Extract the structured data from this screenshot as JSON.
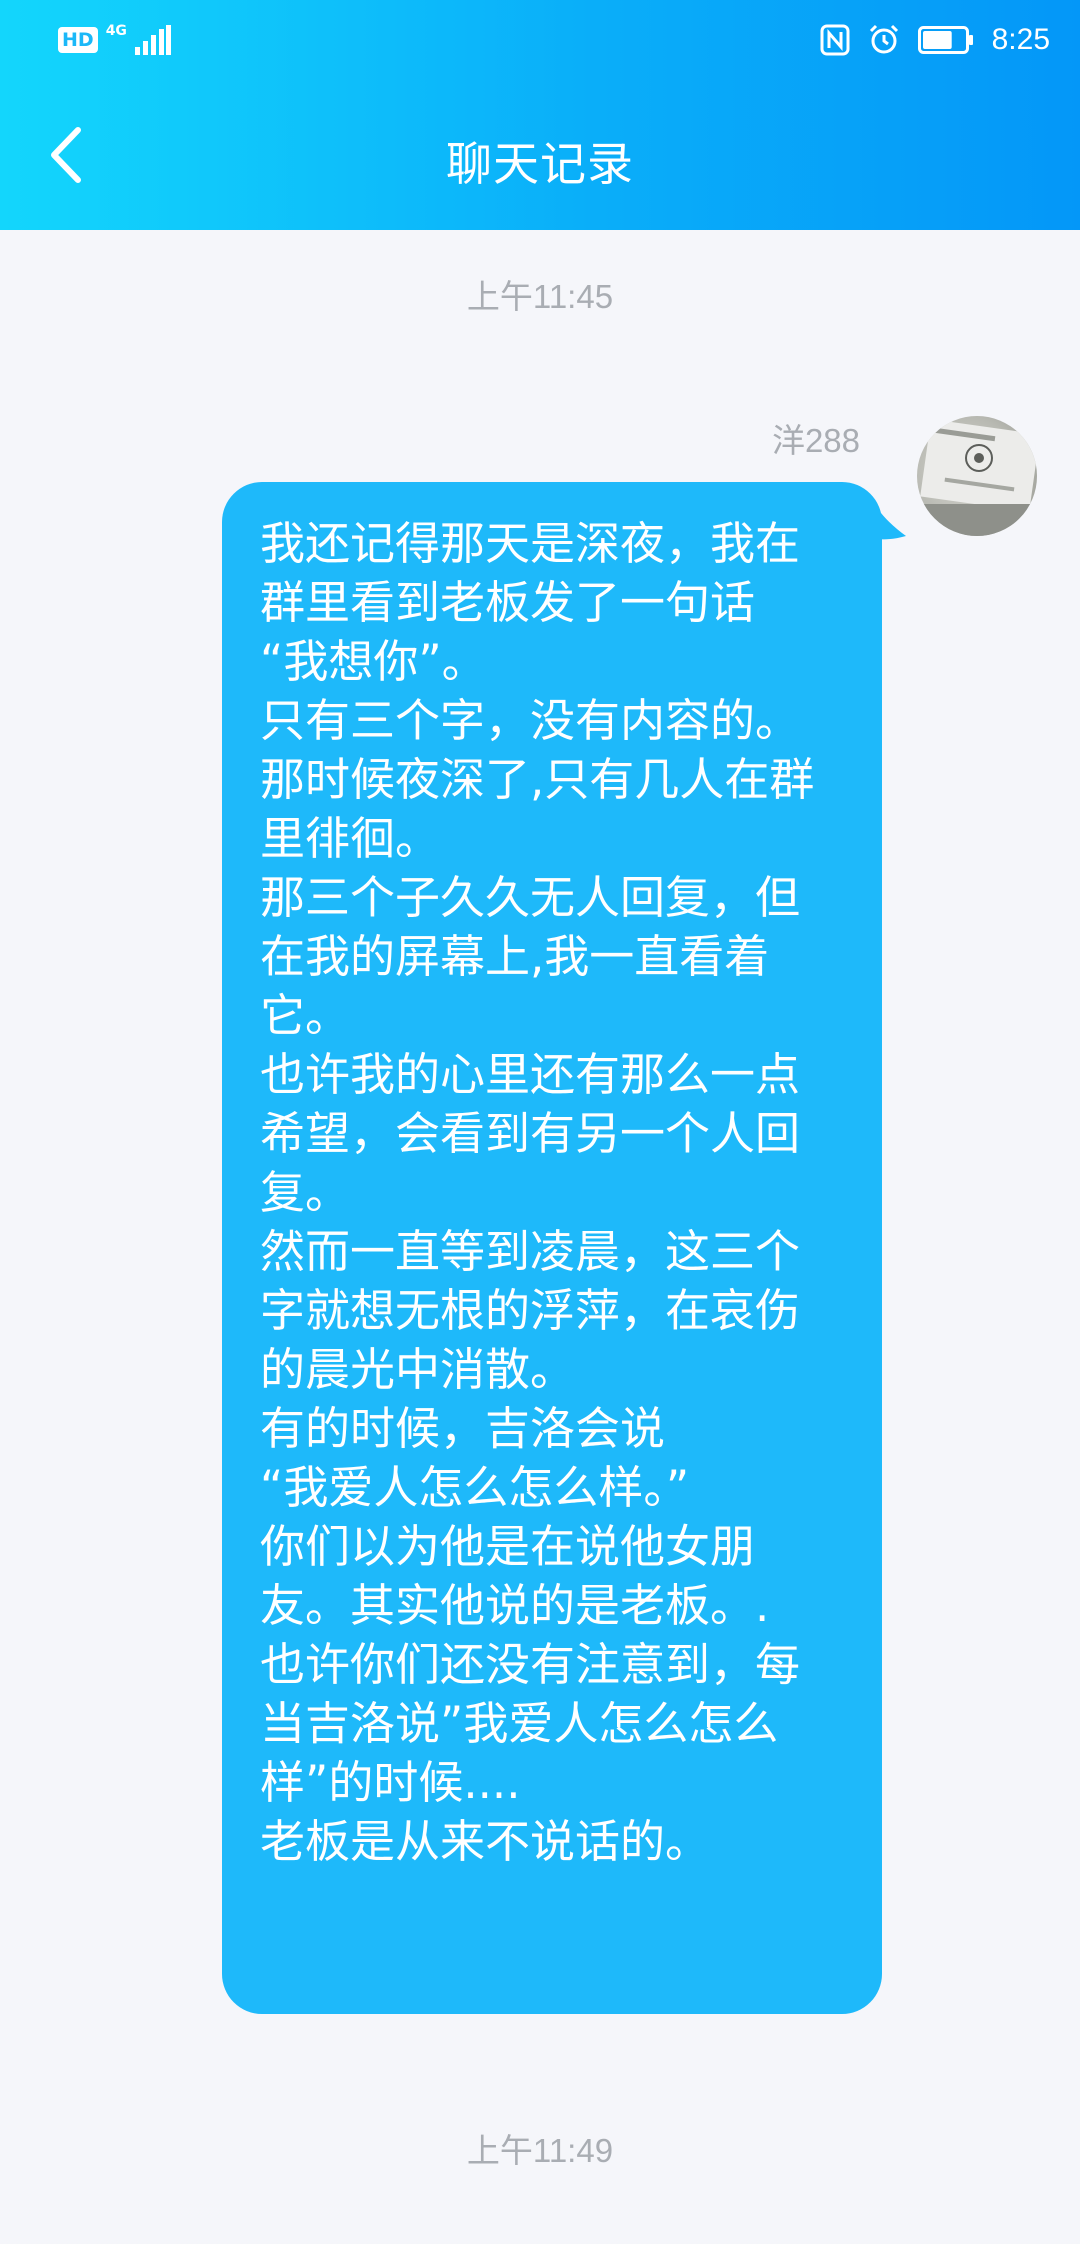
{
  "status_bar": {
    "hd": "HD",
    "network": "4G",
    "time": "8:25",
    "battery_level": 0.7,
    "icons": [
      "hd-icon",
      "4g-signal-icon",
      "nfc-icon",
      "alarm-icon",
      "battery-icon"
    ]
  },
  "header": {
    "title": "聊天记录",
    "back_icon": "chevron-left-icon",
    "gradient": [
      "#13d6fc",
      "#0497f8"
    ]
  },
  "messages": {
    "timestamp_top": "上午11:45",
    "timestamp_bottom": "上午11:49",
    "sender": "洋288",
    "avatar_icon": "avatar-photo",
    "bubble_color": "#1eb9fa",
    "text": "我还记得那天是深夜，我在群里看到老板发了一句话\n“我想你”。\n只有三个字，没有内容的。\n那时候夜深了,只有几人在群里徘徊。\n那三个子久久无人回复，但在我的屏幕上,我一直看着它。\n也许我的心里还有那么一点希望，会看到有另一个人回复。\n然而一直等到凌晨，这三个字就想无根的浮萍，在哀伤的晨光中消散。\n有的时候，吉洛会说\n“我爱人怎么怎么样。”\n你们以为他是在说他女朋友。其实他说的是老板。.\n也许你们还没有注意到，每当吉洛说”我爱人怎么怎么样”的时候....\n老板是从来不说话的。"
  }
}
